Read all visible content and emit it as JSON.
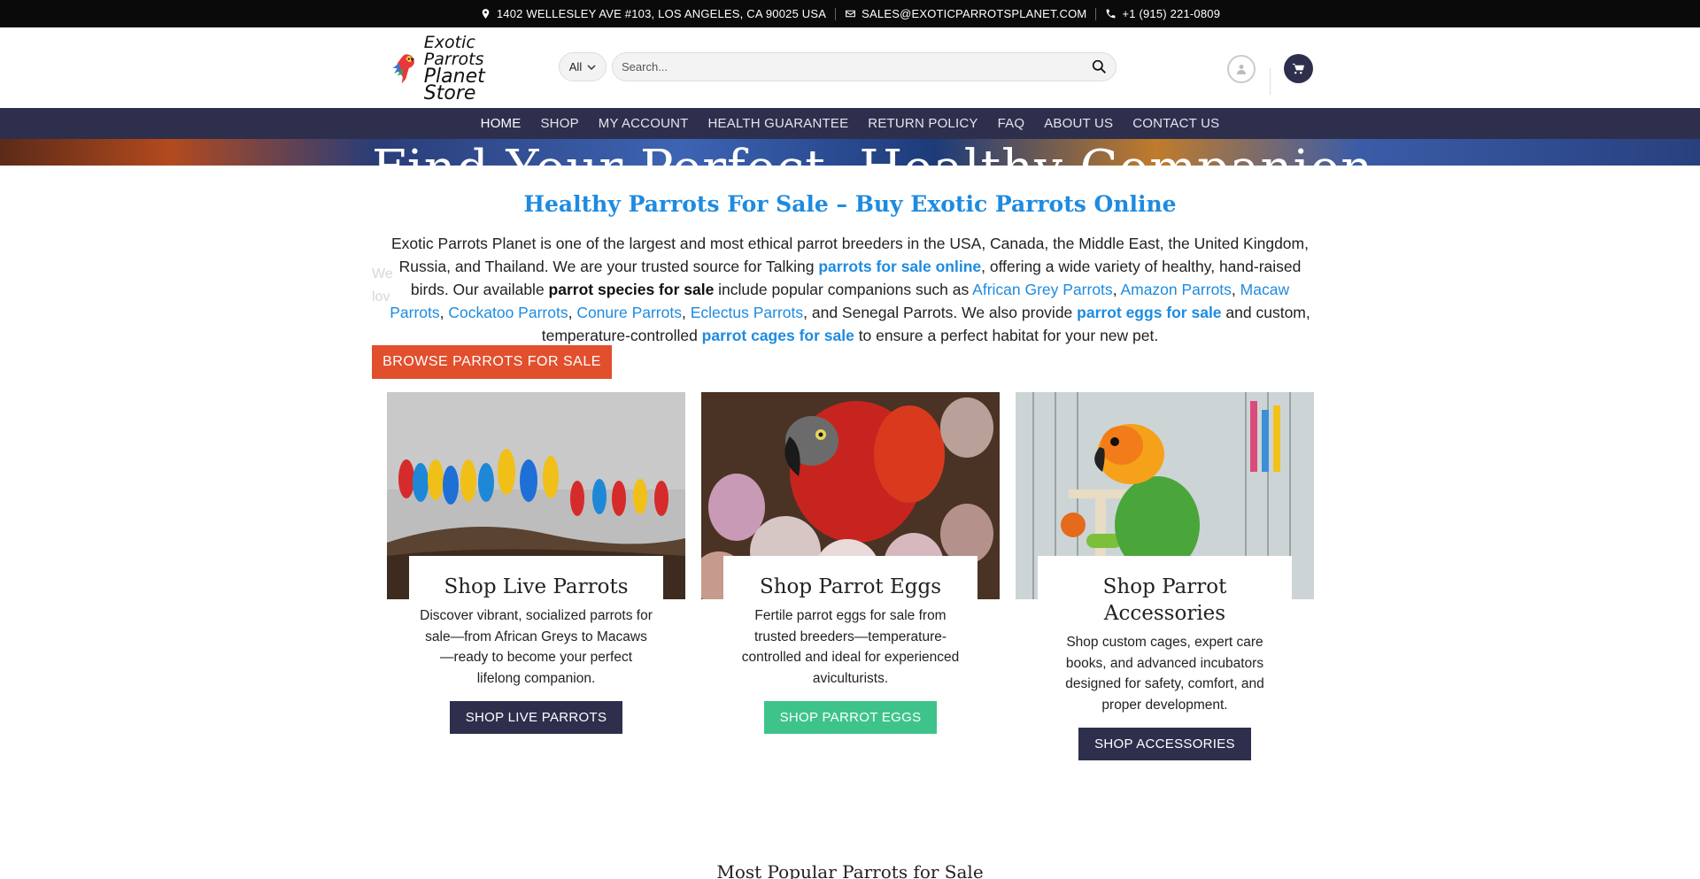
{
  "topbar": {
    "address": "1402 WELLESLEY AVE #103, LOS ANGELES, CA 90025 USA",
    "email": "SALES@EXOTICPARROTSPLANET.COM",
    "phone": "+1 (915) 221-0809"
  },
  "header": {
    "logo_line1": "Exotic Parrots",
    "logo_line2": "Planet Store",
    "category_select": "All",
    "search_placeholder": "Search..."
  },
  "nav": {
    "items": [
      "HOME",
      "SHOP",
      "MY ACCOUNT",
      "HEALTH GUARANTEE",
      "RETURN POLICY",
      "FAQ",
      "ABOUT US",
      "CONTACT US"
    ]
  },
  "hero": {
    "title": "Find Your Perfect, Healthy Companion",
    "ghost_line1": "We",
    "ghost_line2": "lov",
    "browse_button": "BROWSE PARROTS FOR SALE"
  },
  "intro": {
    "heading": "Healthy Parrots For Sale – Buy Exotic Parrots Online",
    "p1": "Exotic Parrots Planet is one of the largest and most ethical parrot breeders in the USA, Canada, the Middle East, the United Kingdom, Russia, and Thailand. We are your trusted source for Talking ",
    "link1": "parrots for sale online",
    "p2": ", offering a wide variety of healthy, hand-raised birds. Our available ",
    "bold1": "parrot species for sale",
    "p3": " include popular companions such as ",
    "link_african": "African Grey Parrots",
    "comma1": ", ",
    "link_amazon": "Amazon Parrots",
    "comma2": ", ",
    "link_macaw": "Macaw Parrots",
    "comma3": ", ",
    "link_cockatoo": "Cockatoo Parrots",
    "comma4": ", ",
    "link_conure": "Conure Parrots",
    "comma5": ", ",
    "link_eclectus": "Eclectus Parrots",
    "p4": ", and Senegal Parrots. We also provide ",
    "link_eggs": "parrot eggs for sale",
    "p5": " and custom, temperature-controlled ",
    "link_cages": "parrot cages for sale",
    "p6": " to ensure a perfect habitat for your new pet."
  },
  "cards": [
    {
      "title": "Shop Live Parrots",
      "desc": "Discover vibrant, socialized parrots for sale—from African Greys to Macaws—ready to become your perfect lifelong companion.",
      "button": "SHOP LIVE PARROTS"
    },
    {
      "title": "Shop Parrot Eggs",
      "desc": "Fertile parrot eggs for sale from trusted breeders—temperature-controlled and ideal for experienced aviculturists.",
      "button": "SHOP PARROT EGGS"
    },
    {
      "title": "Shop Parrot Accessories",
      "desc": "Shop custom cages, expert care books, and advanced incubators designed for safety, comfort, and proper development.",
      "button": "SHOP ACCESSORIES"
    }
  ],
  "popular_heading": "Most Popular Parrots for Sale",
  "colors": {
    "nav_bg": "#2e2f4c",
    "accent_blue": "#1e8be0",
    "browse_orange": "#e24f2d",
    "eggs_green": "#3ec48a"
  }
}
